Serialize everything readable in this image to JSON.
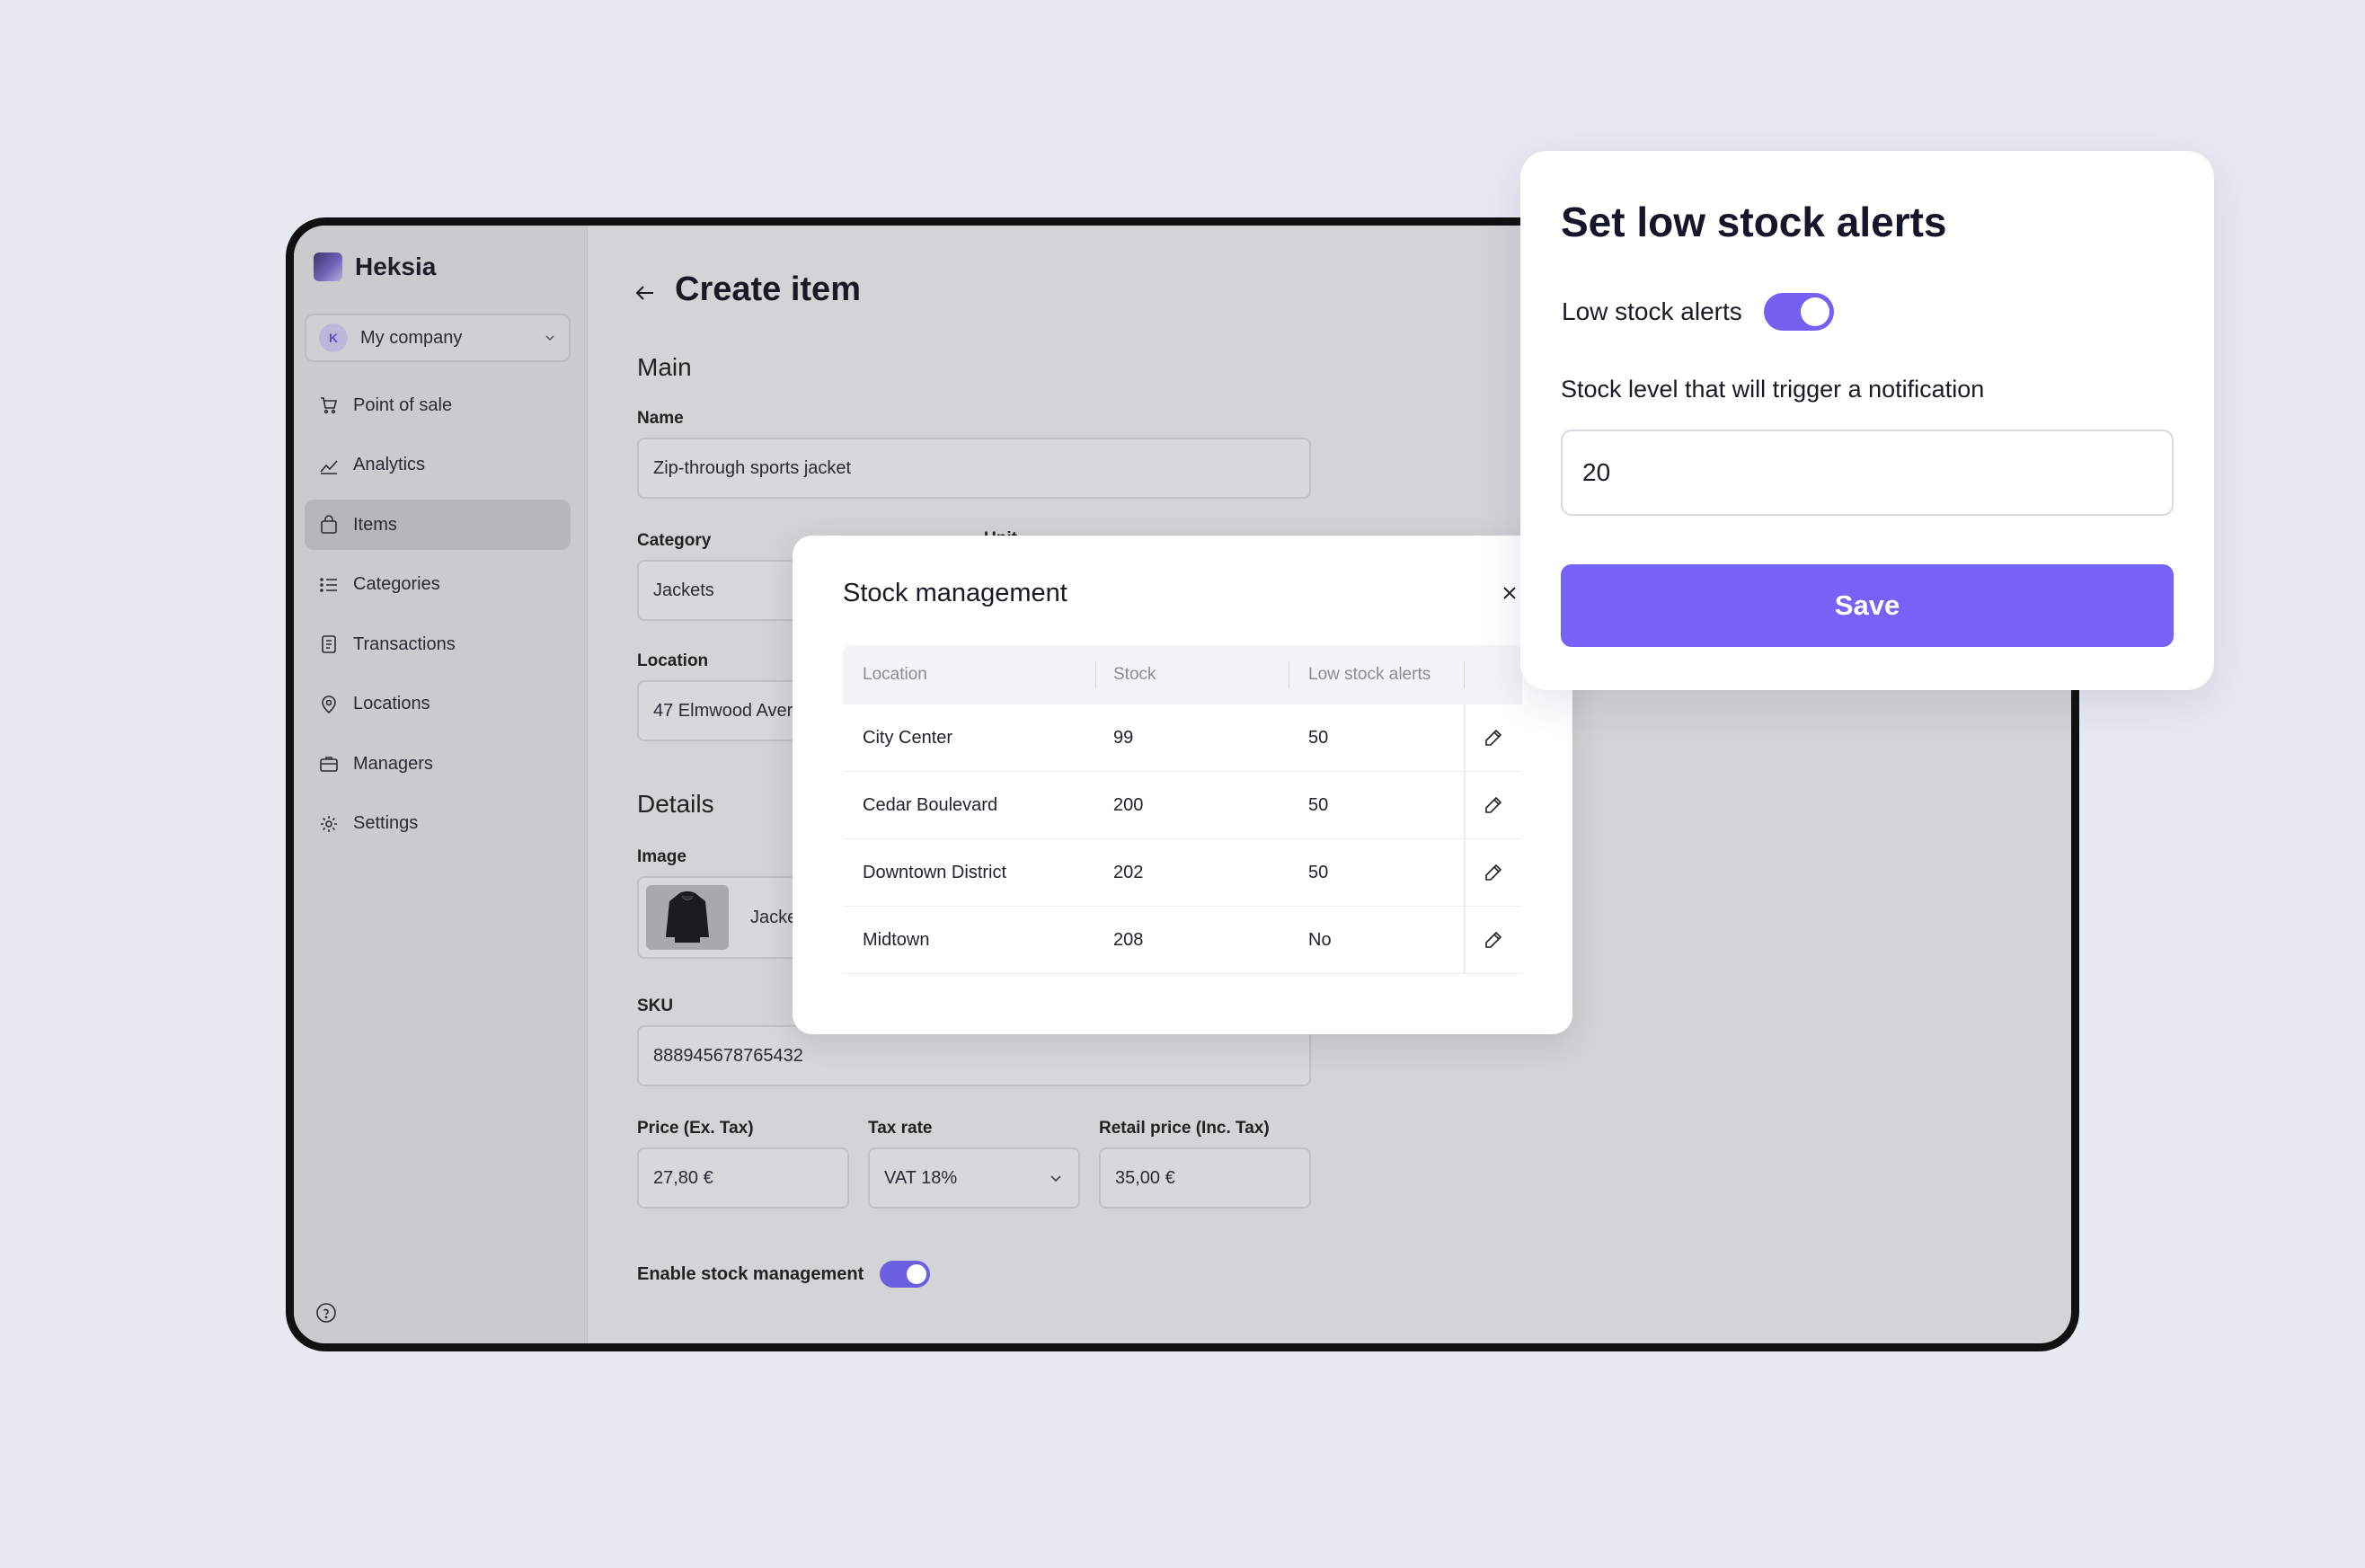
{
  "sidebar": {
    "brand": "Heksia",
    "company": {
      "avatar": "K",
      "name": "My company"
    },
    "items": [
      {
        "label": "Point of sale",
        "icon": "cart-icon"
      },
      {
        "label": "Analytics",
        "icon": "chart-icon"
      },
      {
        "label": "Items",
        "icon": "bag-icon",
        "active": true
      },
      {
        "label": "Categories",
        "icon": "list-icon"
      },
      {
        "label": "Transactions",
        "icon": "receipt-icon"
      },
      {
        "label": "Locations",
        "icon": "pin-icon"
      },
      {
        "label": "Managers",
        "icon": "briefcase-icon"
      },
      {
        "label": "Settings",
        "icon": "gear-icon"
      }
    ]
  },
  "main": {
    "title": "Create item",
    "section_main": "Main",
    "name_label": "Name",
    "name_value": "Zip-through sports jacket",
    "category_label": "Category",
    "category_value": "Jackets",
    "unit_label": "Unit",
    "location_label": "Location",
    "location_value": "47 Elmwood Aver",
    "section_details": "Details",
    "image_label": "Image",
    "image_name": "Jacke",
    "sku_label": "SKU",
    "sku_value": "888945678765432",
    "price_label": "Price (Ex. Tax)",
    "price_value": "27,80 €",
    "tax_label": "Tax rate",
    "tax_value": "VAT 18%",
    "retail_label": "Retail price (Inc. Tax)",
    "retail_value": "35,00 €",
    "stock_toggle_label": "Enable stock management",
    "stock_toggle_on": true
  },
  "stock_modal": {
    "title": "Stock management",
    "columns": [
      "Location",
      "Stock",
      "Low stock alerts"
    ],
    "rows": [
      {
        "location": "City Center",
        "stock": "99",
        "alerts": "50"
      },
      {
        "location": "Cedar Boulevard",
        "stock": "200",
        "alerts": "50"
      },
      {
        "location": "Downtown District",
        "stock": "202",
        "alerts": "50"
      },
      {
        "location": "Midtown",
        "stock": "208",
        "alerts": "No"
      }
    ]
  },
  "alert_card": {
    "title": "Set low stock alerts",
    "toggle_label": "Low stock alerts",
    "toggle_on": true,
    "threshold_label": "Stock level that will trigger a notification",
    "threshold_value": "20",
    "save_label": "Save"
  },
  "colors": {
    "accent": "#7762f8",
    "page_bg": "#e8eaf2"
  }
}
